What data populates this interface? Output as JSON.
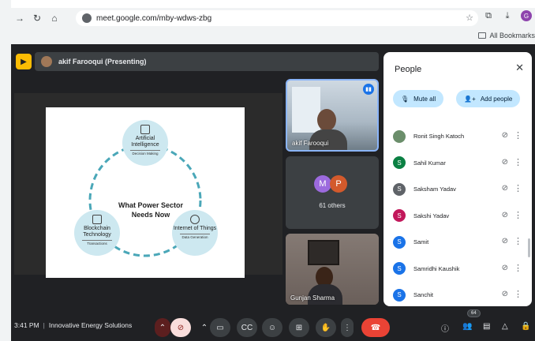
{
  "browser": {
    "url": "meet.google.com/mby-wdws-zbg",
    "bookmarks_label": "All Bookmarks",
    "profile_initial": "G"
  },
  "meet": {
    "presenter_label": "akif Farooqui (Presenting)",
    "slide": {
      "title": "What Power Sector Needs Now",
      "nodes": [
        {
          "title": "Artificial Intelligence",
          "sub": "Decision Making"
        },
        {
          "title": "Blockchain Technology",
          "sub": "Transactions"
        },
        {
          "title": "Internet of Things",
          "sub": "Data Generation"
        }
      ]
    },
    "tiles": {
      "akif_name": "akif Farooqui",
      "others_label": "61 others",
      "others_initials": [
        "M",
        "P"
      ],
      "gunjan_name": "Gunjan Sharma"
    }
  },
  "people_panel": {
    "title": "People",
    "mute_all": "Mute all",
    "add_people": "Add people",
    "participants": [
      {
        "name": "Ronit Singh Katoch",
        "initial": "",
        "color": "#6b8e6b"
      },
      {
        "name": "Sahil Kumar",
        "initial": "S",
        "color": "#0b8043"
      },
      {
        "name": "Saksham Yadav",
        "initial": "S",
        "color": "#5f6368"
      },
      {
        "name": "Sakshi Yadav",
        "initial": "S",
        "color": "#c2185b"
      },
      {
        "name": "Samit",
        "initial": "S",
        "color": "#1a73e8"
      },
      {
        "name": "Samridhi Kaushik",
        "initial": "S",
        "color": "#1a73e8"
      },
      {
        "name": "Sanchit",
        "initial": "S",
        "color": "#1a73e8"
      }
    ]
  },
  "bottom_bar": {
    "time": "3:41 PM",
    "meeting_name": "Innovative Energy Solutions",
    "participant_count": "64"
  }
}
